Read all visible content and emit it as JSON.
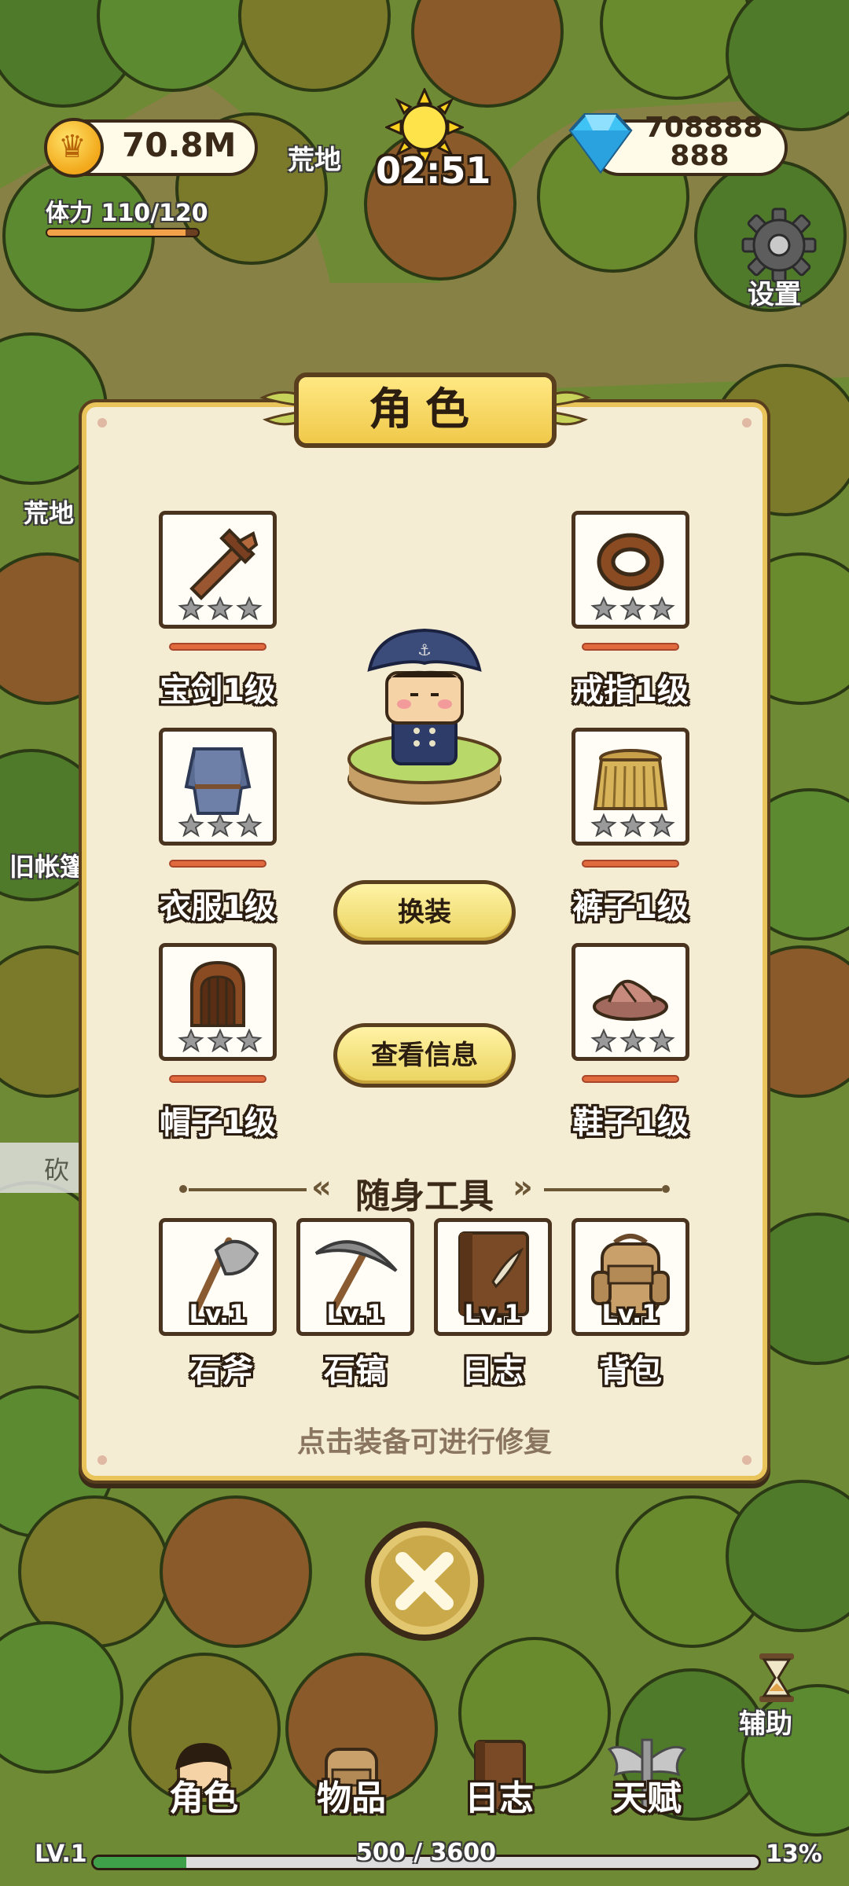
{
  "hud": {
    "coins": "70.8M",
    "zone": "荒地",
    "clock": "02:51",
    "gems_line1": "708888",
    "gems_line2": "888",
    "stamina": "体力 110/120",
    "stamina_fraction": 0.917,
    "settings_label": "设置"
  },
  "map_labels": {
    "zone": "荒地",
    "camp": "旧帐篷",
    "chop": "砍"
  },
  "panel": {
    "title": "角色",
    "equipment": [
      {
        "label": "宝剑1级",
        "icon": "sword-icon",
        "stars": 0
      },
      {
        "label": "戒指1级",
        "icon": "ring-icon",
        "stars": 0
      },
      {
        "label": "衣服1级",
        "icon": "clothes-icon",
        "stars": 0
      },
      {
        "label": "裤子1级",
        "icon": "grass-skirt-icon",
        "stars": 0
      },
      {
        "label": "帽子1级",
        "icon": "hat-icon",
        "stars": 0
      },
      {
        "label": "鞋子1级",
        "icon": "sandal-icon",
        "stars": 0
      }
    ],
    "change_outfit_button": "换装",
    "view_info_button": "查看信息",
    "tools_title": "随身工具",
    "tools": [
      {
        "label": "石斧",
        "level": "Lv.1",
        "icon": "stone-axe-icon"
      },
      {
        "label": "石镐",
        "level": "Lv.1",
        "icon": "stone-pickaxe-icon"
      },
      {
        "label": "日志",
        "level": "Lv.1",
        "icon": "journal-icon"
      },
      {
        "label": "背包",
        "level": "Lv.1",
        "icon": "backpack-icon"
      }
    ],
    "repair_hint": "点击装备可进行修复"
  },
  "bottom": {
    "assist_label": "辅助",
    "nav": [
      "角色",
      "物品",
      "日志",
      "天赋"
    ],
    "level": "LV.1",
    "xp": "500 / 3600",
    "xp_fraction": 0.139,
    "xp_percent": "13%"
  },
  "colors": {
    "panel_bg": "#f4ecd3",
    "panel_border": "#e8c45a",
    "durability_bar": "#e06a3e",
    "xp_fill": "#3fa04a",
    "stamina_fill": "#f4a24a"
  }
}
